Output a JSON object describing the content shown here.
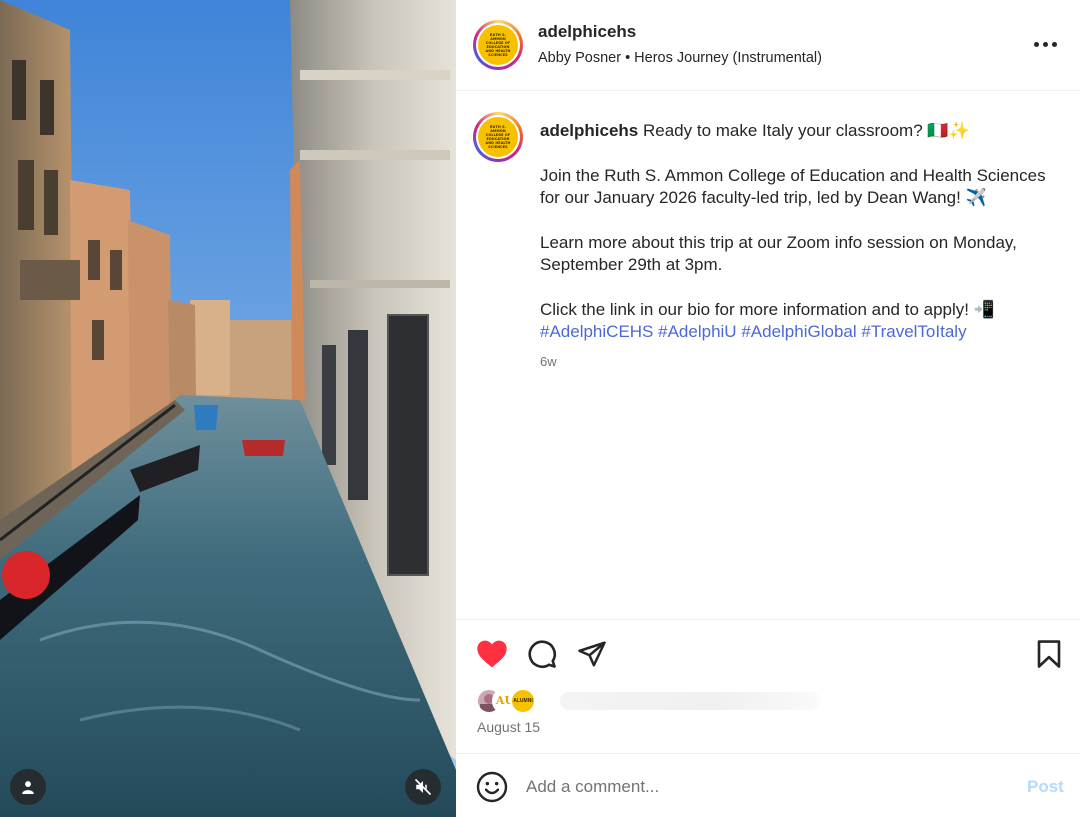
{
  "post": {
    "username": "adelphicehs",
    "avatar_text": "RUTH S. AMMON COLLEGE OF EDUCATION AND HEALTH SCIENCES",
    "audio_artist": "Abby Posner",
    "audio_separator": "•",
    "audio_track": "Heros Journey (Instrumental)",
    "more_icon": "more-horizontal-icon"
  },
  "caption": {
    "username": "adelphicehs",
    "line1": "Ready to make Italy your classroom? 🇮🇹✨",
    "line2": "Join the Ruth S. Ammon College of Education and Health Sciences for our January 2026 faculty-led trip, led by Dean Wang! ✈️",
    "line3": "Learn more about this trip at our Zoom info session on Monday, September 29th at 3pm.",
    "line4": "Click the link in our bio for more information and to apply! 📲",
    "hashtags": [
      "#AdelphiCEHS",
      "#AdelphiU",
      "#AdelphiGlobal",
      "#TravelToItaly"
    ],
    "time_ago": "6w"
  },
  "actions": {
    "like_icon": "heart-filled-icon",
    "comment_icon": "comment-icon",
    "share_icon": "send-icon",
    "save_icon": "bookmark-icon",
    "like_color": "#ff3040"
  },
  "likes": {
    "liker_avatar_2_text": "AU",
    "liker_avatar_3_text": "ALUMNI"
  },
  "date": "August 15",
  "comment": {
    "placeholder": "Add a comment...",
    "post_label": "Post",
    "post_color": "#b3dbff"
  },
  "media": {
    "tag_icon": "user-tag-icon",
    "mute_icon": "speaker-muted-icon"
  }
}
